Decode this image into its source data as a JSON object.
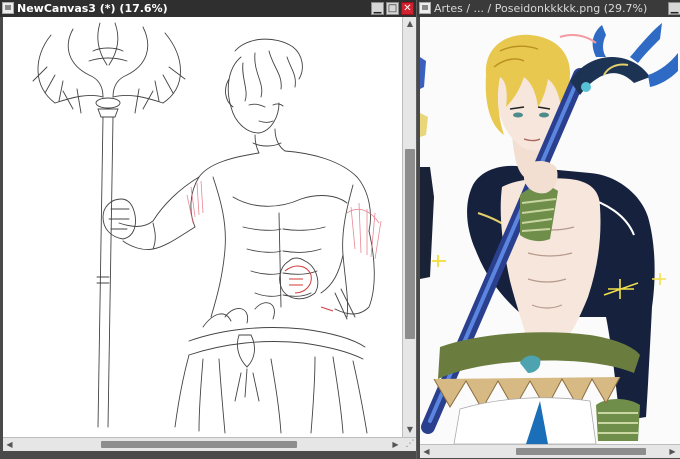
{
  "left_window": {
    "title": "NewCanvas3 (*) (17.6%)",
    "icons": [
      "app-icon",
      "minimize-icon",
      "maximize-icon",
      "close-icon"
    ],
    "controls": {
      "minimize": "▁",
      "maximize": "□",
      "close": "✕"
    },
    "artwork": "pencil line sketch of a man holding a trident",
    "scroll": {
      "up": "▲",
      "down": "▼",
      "left": "◀",
      "right": "▶",
      "grip": "⋰"
    }
  },
  "right_window": {
    "title": "Artes / ... / Poseidonkkkkk.png (29.7%)",
    "icons": [
      "app-icon",
      "minimize-icon"
    ],
    "controls": {
      "minimize": "▁"
    },
    "artwork": "colored illustration of a blonde man in navy armor holding a blue trident",
    "scroll": {
      "left": "◀",
      "right": "▶"
    }
  },
  "colors": {
    "titlebar": "#2f2f2f",
    "close": "#d0212e",
    "workspace": "#4a4a4a",
    "navy": "#16213e",
    "gold": "#e4cf6b",
    "trident_blue": "#3d68c8"
  }
}
